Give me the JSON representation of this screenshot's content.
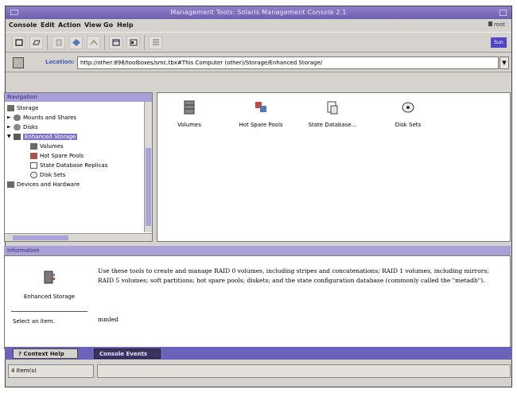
{
  "window": {
    "title": "Management Tools: Solaris Management Console 2.1"
  },
  "menubar": {
    "items": [
      "Console",
      "Edit",
      "Action",
      "View",
      "Go",
      "Help"
    ],
    "user": "root"
  },
  "toolbar": {
    "icons": [
      "console-icon",
      "open-icon",
      "cut-icon",
      "navigate-icon",
      "up-icon",
      "find-icon",
      "view-icon",
      "details-icon"
    ],
    "brand_label": "Sun"
  },
  "location": {
    "label": "Location:",
    "value": "http://other:898/toolboxes/smc.tbx#This Computer (other)/Storage/Enhanced Storage/"
  },
  "navigation": {
    "header": "Navigation",
    "items": [
      {
        "label": "Storage",
        "icon": "storage-icon"
      },
      {
        "label": "Mounts and Shares",
        "icon": "mounts-icon"
      },
      {
        "label": "Disks",
        "icon": "disks-icon"
      },
      {
        "label": "Enhanced Storage",
        "icon": "enhanced-storage-icon"
      },
      {
        "label": "Volumes",
        "icon": "volumes-icon"
      },
      {
        "label": "Hot Spare Pools",
        "icon": "hot-spare-icon"
      },
      {
        "label": "State Database Replicas",
        "icon": "state-db-icon"
      },
      {
        "label": "Disk Sets",
        "icon": "disk-sets-icon"
      },
      {
        "label": "Devices and Hardware",
        "icon": "devices-icon"
      }
    ]
  },
  "content": {
    "tiles": [
      {
        "label": "Volumes",
        "icon": "volumes-icon"
      },
      {
        "label": "Hot Spare Pools",
        "icon": "hot-spare-icon"
      },
      {
        "label": "State Database...",
        "icon": "state-db-icon"
      },
      {
        "label": "Disk Sets",
        "icon": "disk-sets-icon"
      }
    ]
  },
  "information": {
    "header": "Information",
    "tool_label": "Enhanced Storage",
    "select_label": "Select an item.",
    "text": "Use these tools to create and manage RAID 0 volumes, including stripes and concatenations; RAID 1 volumes, including mirrors; RAID 5 volumes; soft partitions; hot spare pools; diskets; and the state configuration database (commonly called the \"metadb\").",
    "text2": "mmled"
  },
  "tabs": {
    "context_help": "Context Help",
    "console_events": "Console Events"
  },
  "status": {
    "count": "4 Item(s)"
  },
  "colors": {
    "accent": "#7b74c9",
    "titlebar": "#6e5fb2"
  }
}
